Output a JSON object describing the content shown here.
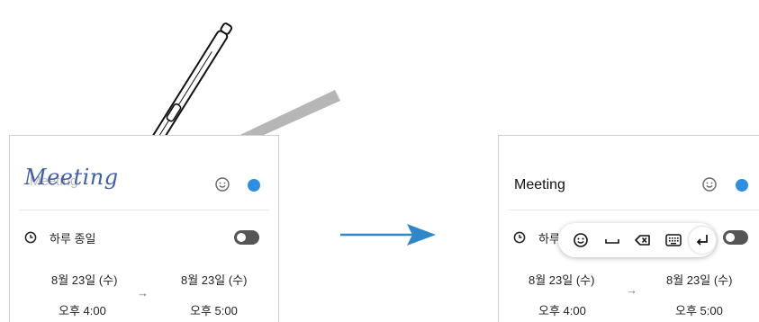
{
  "accent_color": "#2d8ee3",
  "arrow_color": "#2f86c8",
  "left": {
    "handwriting": "Meeting",
    "ghost_title": "Meeting",
    "allday_label": "하루 종일",
    "start_date": "8월 23일 (수)",
    "end_date": "8월 23일 (수)",
    "start_time": "오후 4:00",
    "end_time": "오후 5:00",
    "range_arrow": "→"
  },
  "right": {
    "title": "Meeting",
    "allday_label": "하루",
    "start_date": "8월 23일 (수)",
    "end_date": "8월 23일 (수)",
    "start_time": "오후 4:00",
    "end_time": "오후 5:00",
    "range_arrow": "→"
  },
  "icons": {
    "emoji": "smiley-icon",
    "clock": "clock-icon",
    "space": "space-icon",
    "backspace": "backspace-icon",
    "keyboard": "keyboard-icon",
    "enter": "enter-icon",
    "stylus": "s-pen-icon",
    "transition": "arrow-right-icon"
  }
}
